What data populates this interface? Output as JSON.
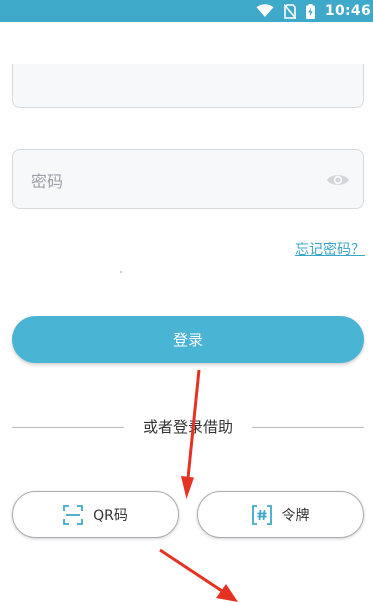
{
  "status_bar": {
    "time": "10:46",
    "background": "#3fa9c9",
    "icons": [
      "wifi-icon",
      "no-sim-icon",
      "battery-charging-icon"
    ]
  },
  "form": {
    "password_placeholder": "密码",
    "password_visibility_icon": "eye-icon",
    "forgot_password": "忘记密码？",
    "login_button": "登录"
  },
  "alternatives": {
    "divider_text": "或者登录借助",
    "qr_button": {
      "label": "QR码",
      "icon": "qr-scan-icon"
    },
    "token_button": {
      "label": "令牌",
      "icon": "token-hash-icon"
    }
  },
  "colors": {
    "accent": "#4ab4d4",
    "link": "#3aa6c7",
    "annotation_arrow": "#e53223"
  }
}
